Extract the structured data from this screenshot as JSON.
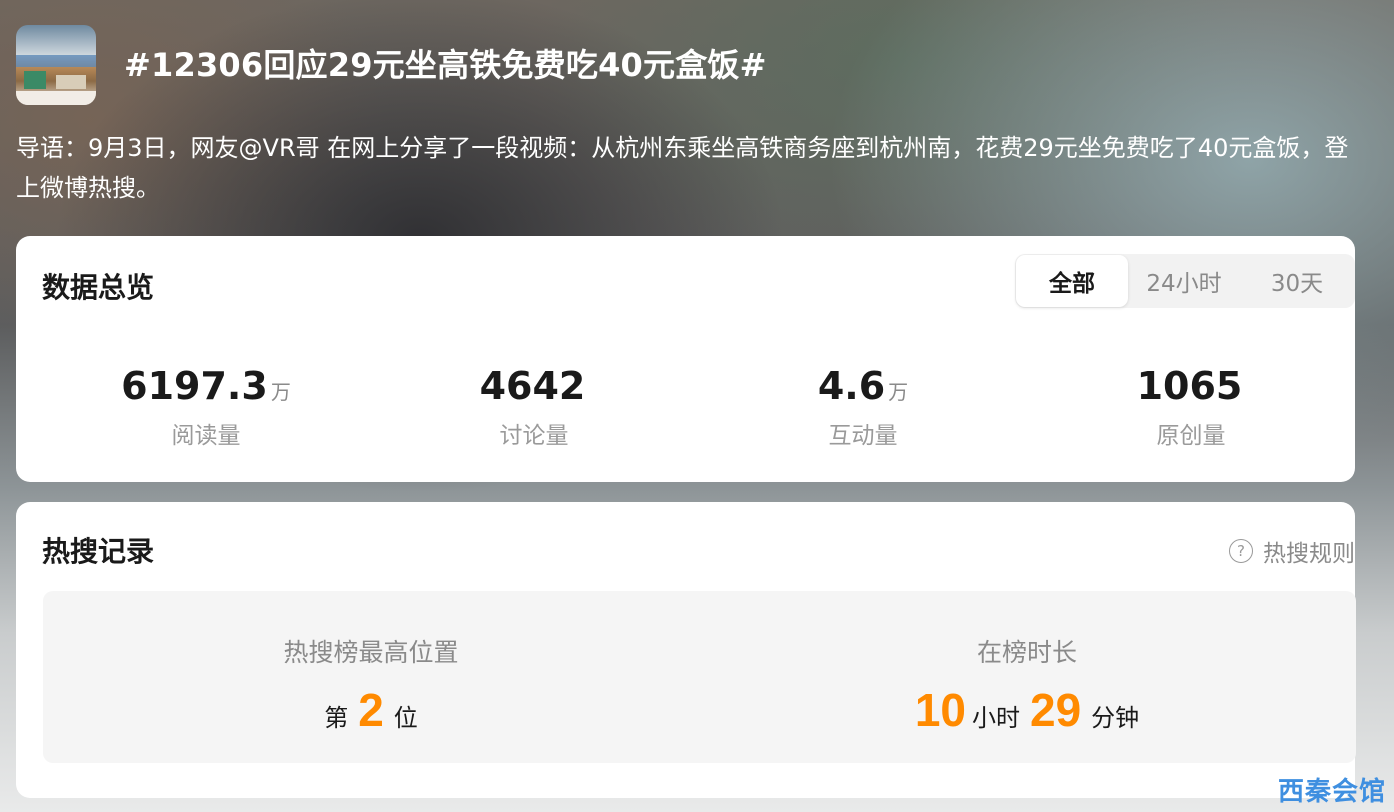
{
  "topic": {
    "title": "#12306回应29元坐高铁免费吃40元盒饭#",
    "intro": "导语：9月3日，网友@VR哥 在网上分享了一段视频：从杭州东乘坐高铁商务座到杭州南，花费29元坐免费吃了40元盒饭，登上微博热搜。"
  },
  "overview": {
    "title": "数据总览",
    "tabs": [
      {
        "label": "全部",
        "active": true
      },
      {
        "label": "24小时",
        "active": false
      },
      {
        "label": "30天",
        "active": false
      }
    ],
    "stats": [
      {
        "value": "6197.3",
        "unit": "万",
        "label": "阅读量"
      },
      {
        "value": "4642",
        "unit": "",
        "label": "讨论量"
      },
      {
        "value": "4.6",
        "unit": "万",
        "label": "互动量"
      },
      {
        "value": "1065",
        "unit": "",
        "label": "原创量"
      }
    ]
  },
  "hot_search": {
    "title": "热搜记录",
    "rules_label": "热搜规则",
    "rules_icon": "question-circle-icon",
    "peak": {
      "label": "热搜榜最高位置",
      "prefix": "第",
      "value": "2",
      "suffix": "位"
    },
    "duration": {
      "label": "在榜时长",
      "hours": "10",
      "hours_unit": "小时",
      "minutes": "29",
      "minutes_unit": "分钟"
    }
  },
  "watermark": "西秦会馆",
  "colors": {
    "accent": "#ff8a00",
    "watermark": "#3f8fe0"
  }
}
